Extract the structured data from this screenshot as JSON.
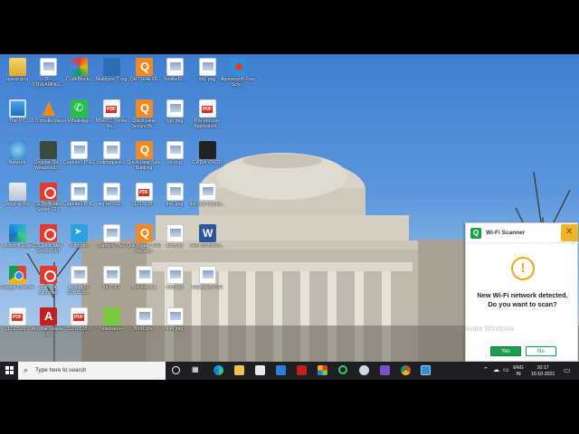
{
  "desktop": {
    "icons": [
      {
        "label": "mavsr.proj",
        "glyph": "folder-icon"
      },
      {
        "label": "ZF-STREAMING...",
        "glyph": "image-icon"
      },
      {
        "label": "CodeBlocks",
        "glyph": "codeblocks-icon"
      },
      {
        "label": "Mathtype 7.reg",
        "glyph": "mathtype-icon"
      },
      {
        "label": "QHTS64EXE",
        "glyph": "installer-icon"
      },
      {
        "label": "Untitled2...",
        "glyph": "image-icon"
      },
      {
        "label": "int1.png",
        "glyph": "image-icon"
      },
      {
        "label": "Apowersoft Free Scre...",
        "glyph": "recorder-icon"
      },
      {
        "label": "This PC",
        "glyph": "computer-icon"
      },
      {
        "label": "VLC media player",
        "glyph": "vlc-icon"
      },
      {
        "label": "WhatsApp",
        "glyph": "whatsapp-icon"
      },
      {
        "label": "MSRTC Online Re...",
        "glyph": "pdf-icon"
      },
      {
        "label": "Quick Heal Secure Br...",
        "glyph": "quickheal-icon"
      },
      {
        "label": "cpp.png",
        "glyph": "image-icon"
      },
      {
        "label": "Pre-process Application...",
        "glyph": "pdf-icon"
      },
      {
        "label": "Network",
        "glyph": "network-icon"
      },
      {
        "label": "Counter-Str... WeaponsD...",
        "glyph": "counter-strike-icon"
      },
      {
        "label": "Capture1.PNG",
        "glyph": "image-icon"
      },
      {
        "label": "codingquest...",
        "glyph": "image-icon"
      },
      {
        "label": "Quick Heal Safe Banking",
        "glyph": "quickheal-icon"
      },
      {
        "label": "int.png",
        "glyph": "image-icon"
      },
      {
        "label": "CATIA V5R20",
        "glyph": "catia-icon"
      },
      {
        "label": "Recycle Bin",
        "glyph": "recycle-bin-icon"
      },
      {
        "label": "CS Dedicated Server CLI",
        "glyph": "cs-server-icon"
      },
      {
        "label": "Capture2.PNG",
        "glyph": "image-icon"
      },
      {
        "label": "wq-rel-001...",
        "glyph": "image-icon"
      },
      {
        "label": "11210528...",
        "glyph": "pdf-icon"
      },
      {
        "label": "int1.png",
        "glyph": "image-icon"
      },
      {
        "label": "dell test results...",
        "glyph": "image-icon"
      },
      {
        "label": "Microsoft Edge",
        "glyph": "edge-icon"
      },
      {
        "label": "CS Dedicated Server GUI",
        "glyph": "cs-server-icon"
      },
      {
        "label": "Telegram",
        "glyph": "telegram-icon"
      },
      {
        "label": "Capture.PNG",
        "glyph": "image-icon"
      },
      {
        "label": "Quick Heal Total Security",
        "glyph": "quickheal-icon"
      },
      {
        "label": "int2.png",
        "glyph": "image-icon"
      },
      {
        "label": "New Microsoft...",
        "glyph": "word-icon"
      },
      {
        "label": "Google Chrome",
        "glyph": "chrome-icon"
      },
      {
        "label": "Half-Life Launcher",
        "glyph": "halflife-icon"
      },
      {
        "label": "receipt 39 50c01c8...",
        "glyph": "image-icon"
      },
      {
        "label": "int.PNG",
        "glyph": "image-icon"
      },
      {
        "label": "Bmi-list.png",
        "glyph": "image-icon"
      },
      {
        "label": "int3.png",
        "glyph": "image-icon"
      },
      {
        "label": "Capture1.PNG",
        "glyph": "image-icon"
      },
      {
        "label": "11210529...",
        "glyph": "pdf-icon"
      },
      {
        "label": "Acrobat Reader DC",
        "glyph": "acrobat-icon"
      },
      {
        "label": "11210528...",
        "glyph": "pdf-icon"
      },
      {
        "label": "Notepad++",
        "glyph": "notepad-icon"
      },
      {
        "label": "Bmi1.png",
        "glyph": "image-icon"
      },
      {
        "label": "int4.png",
        "glyph": "image-icon"
      }
    ]
  },
  "wifi_popup": {
    "title": "Wi-Fi Scanner",
    "message_line1": "New Wi-Fi network detected.",
    "message_line2": "Do you want to scan?",
    "yes_label": "Yes",
    "no_label": "No",
    "watermark": "Activate Windows",
    "brand_color": "#1a9f4a"
  },
  "taskbar": {
    "search_placeholder": "Type here to search",
    "apps": [
      "task-view-icon",
      "widgets-icon",
      "edge-icon",
      "file-explorer-icon",
      "store-icon",
      "mail-icon",
      "acrobat-icon",
      "office-icon",
      "app-green-icon",
      "app-cloud-icon",
      "visual-studio-icon",
      "chrome-icon",
      "screen-recorder-icon"
    ],
    "tray": {
      "language_line1": "ENG",
      "language_line2": "IN",
      "time": "10:17",
      "date": "10-10-2021"
    }
  }
}
